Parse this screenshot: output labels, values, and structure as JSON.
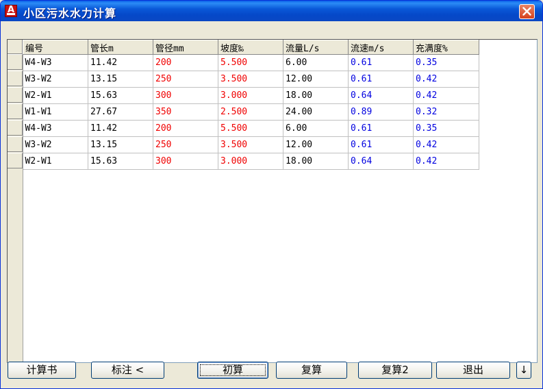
{
  "window": {
    "title": "小区污水水力计算",
    "icon_letter": "A"
  },
  "table": {
    "columns": [
      "编号",
      "管长m",
      "管径mm",
      "坡度‰",
      "流量L/s",
      "流速m/s",
      "充满度%"
    ],
    "rows": [
      [
        "W4-W3",
        "11.42",
        "200",
        "5.500",
        "6.00",
        "0.61",
        "0.35"
      ],
      [
        "W3-W2",
        "13.15",
        "250",
        "3.500",
        "12.00",
        "0.61",
        "0.42"
      ],
      [
        "W2-W1",
        "15.63",
        "300",
        "3.000",
        "18.00",
        "0.64",
        "0.42"
      ],
      [
        "W1-W1",
        "27.67",
        "350",
        "2.500",
        "24.00",
        "0.89",
        "0.32"
      ],
      [
        "W4-W3",
        "11.42",
        "200",
        "5.500",
        "6.00",
        "0.61",
        "0.35"
      ],
      [
        "W3-W2",
        "13.15",
        "250",
        "3.500",
        "12.00",
        "0.61",
        "0.42"
      ],
      [
        "W2-W1",
        "15.63",
        "300",
        "3.000",
        "18.00",
        "0.64",
        "0.42"
      ]
    ],
    "colors": {
      "input": "#F00000",
      "result": "#0000E0",
      "default": "#000000"
    }
  },
  "buttons": {
    "calc_book": "计算书",
    "annotate": "标注 <",
    "initial_calc": "初算",
    "recheck": "复算",
    "recheck2": "复算2",
    "exit": "退出",
    "more": "↓"
  }
}
